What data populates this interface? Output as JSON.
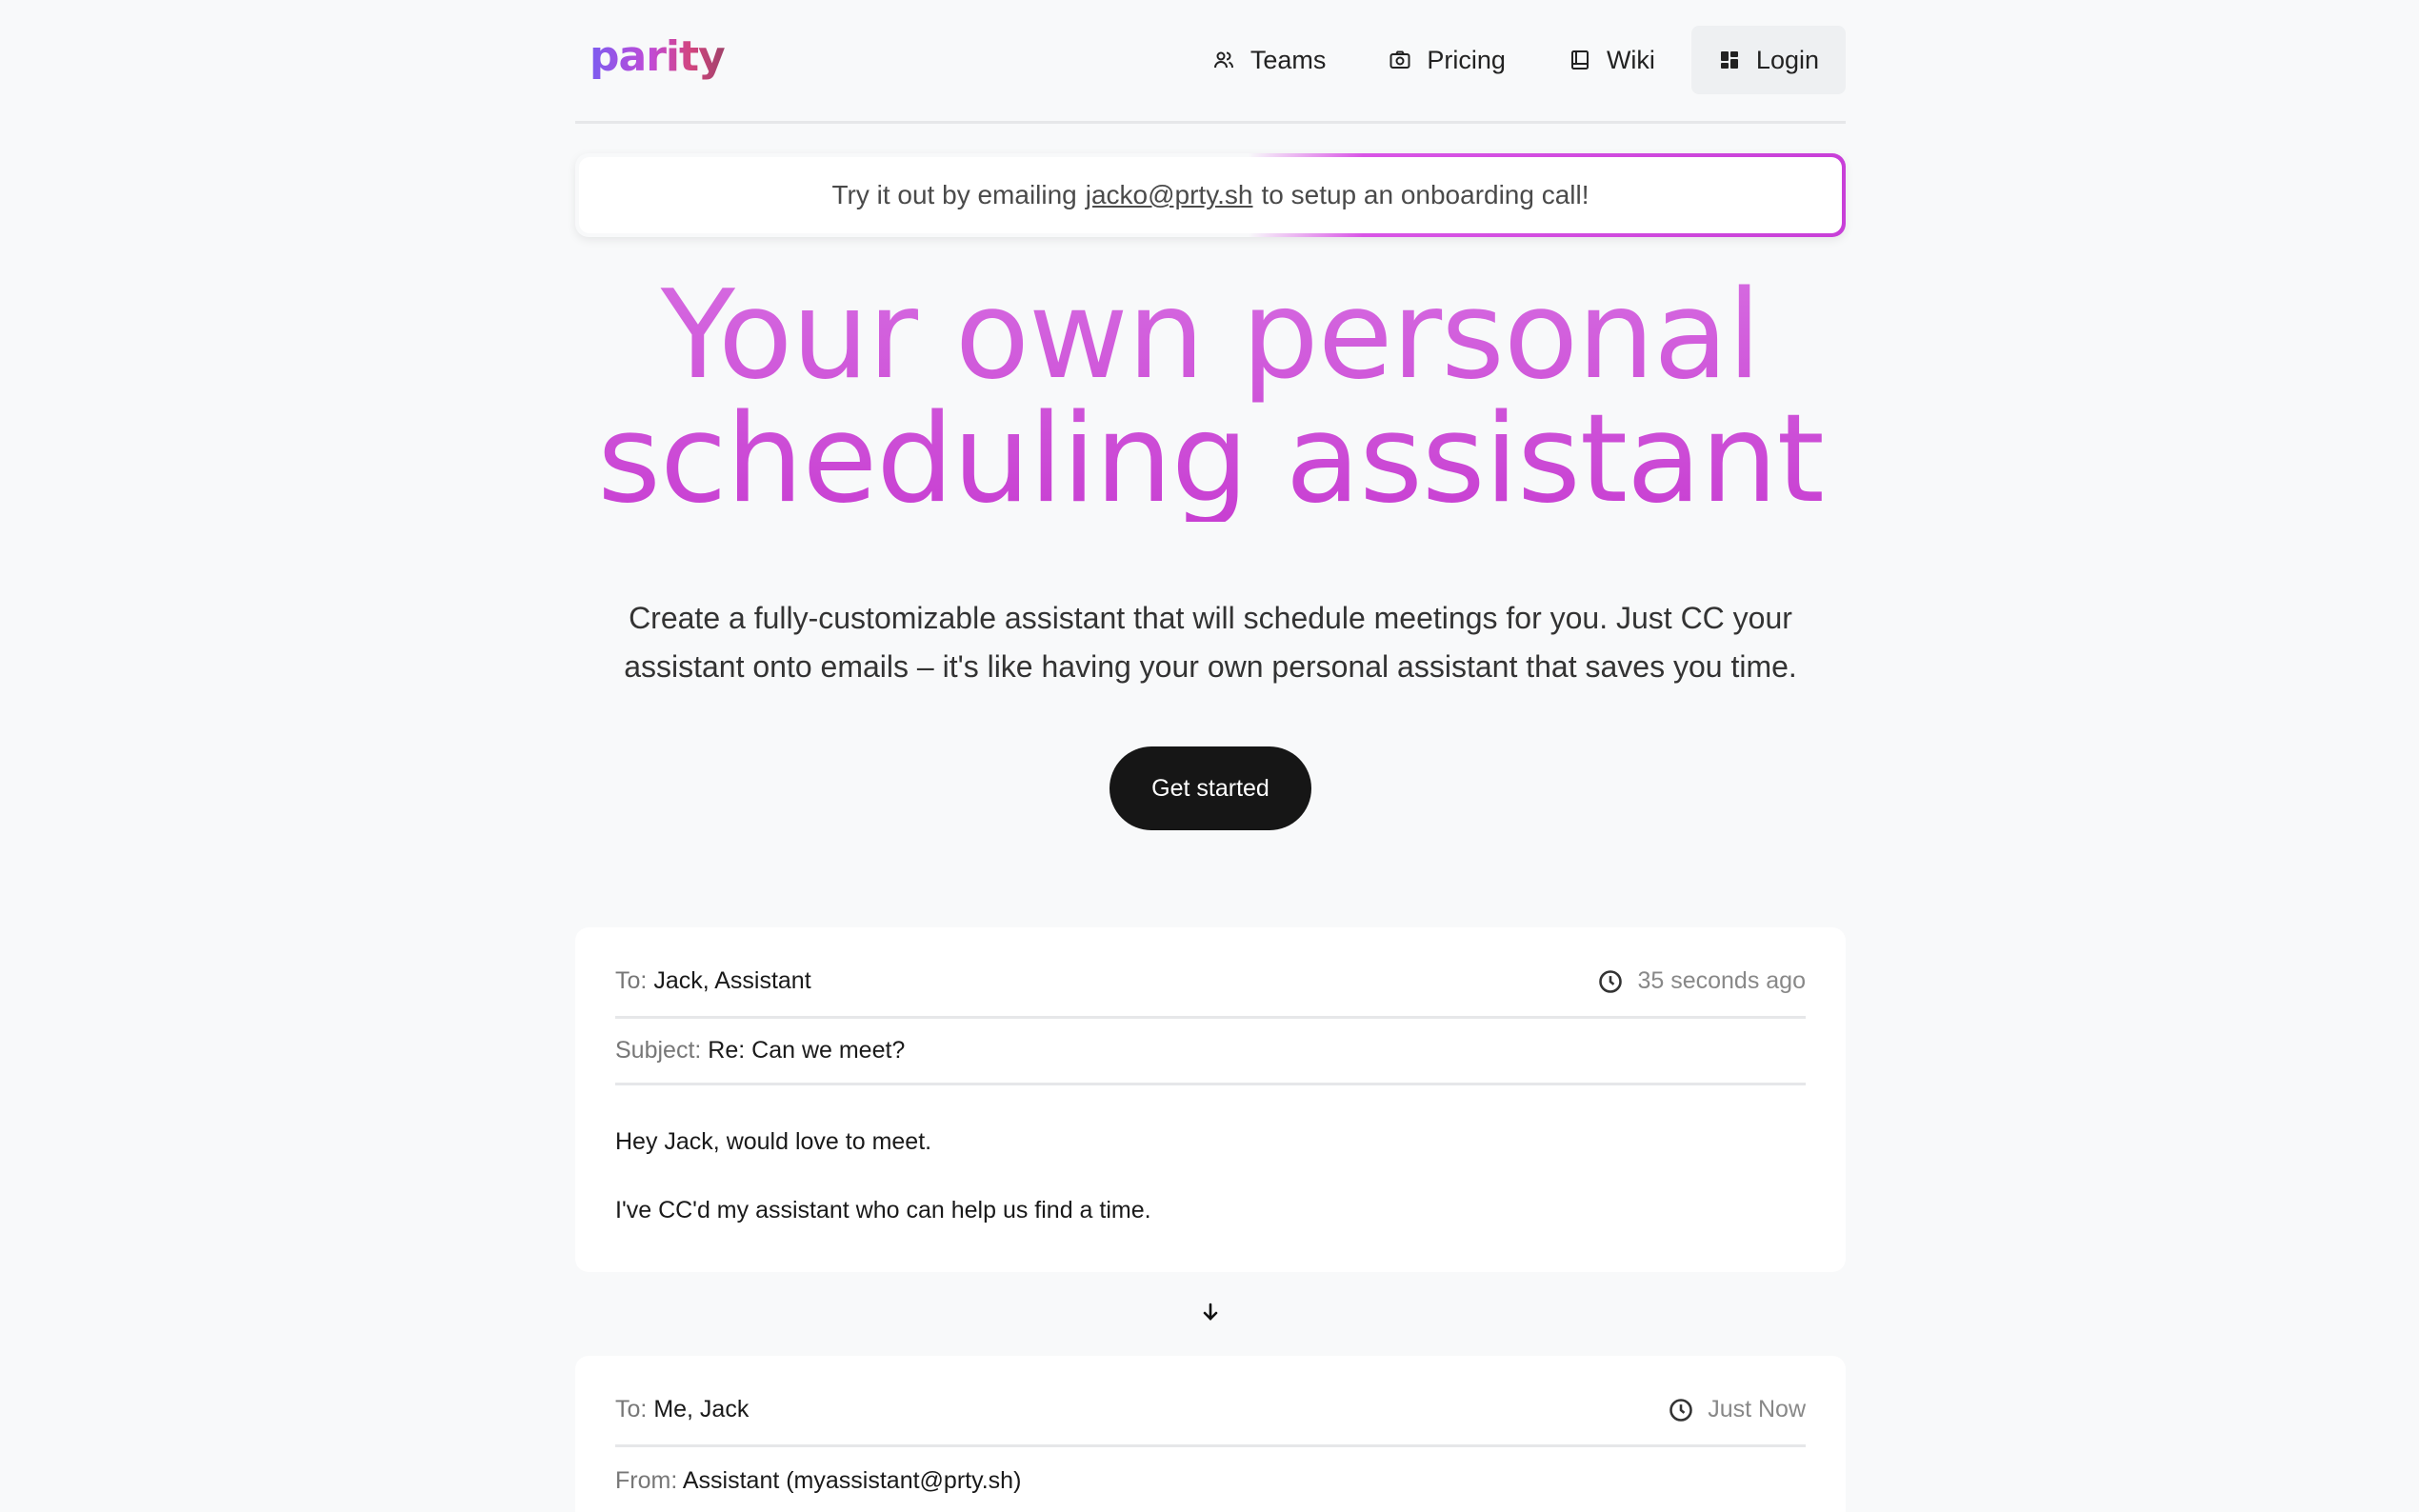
{
  "brand": {
    "logo_text": "parity"
  },
  "nav": {
    "items": [
      {
        "label": "Teams",
        "icon": "users-icon"
      },
      {
        "label": "Pricing",
        "icon": "camera-icon"
      },
      {
        "label": "Wiki",
        "icon": "book-icon"
      },
      {
        "label": "Login",
        "icon": "grid-icon"
      }
    ]
  },
  "banner": {
    "prefix": "Try it out by emailing",
    "email": "jacko@prty.sh",
    "suffix": "to setup an onboarding call!"
  },
  "hero": {
    "title_line1": "Your own personal",
    "title_line2": "scheduling assistant",
    "subtitle_line1": "Create a fully-customizable assistant that will schedule meetings for you. Just CC your",
    "subtitle_line2": "assistant onto emails – it's like having your own personal assistant that saves you time.",
    "cta_label": "Get started"
  },
  "email1": {
    "to_label": "To:",
    "to_value": "Jack, Assistant",
    "time": "35 seconds ago",
    "subject_label": "Subject:",
    "subject_value": "Re: Can we meet?",
    "body_line1": "Hey Jack, would love to meet.",
    "body_line2": "I've CC'd my assistant who can help us find a time."
  },
  "email2": {
    "to_label": "To:",
    "to_value": "Me, Jack",
    "time": "Just Now",
    "from_label": "From:",
    "from_value": "Assistant (myassistant@prty.sh)"
  },
  "colors": {
    "accent": "#c83fd2",
    "cta_bg": "#161616",
    "page_bg": "#f8f9fa"
  }
}
